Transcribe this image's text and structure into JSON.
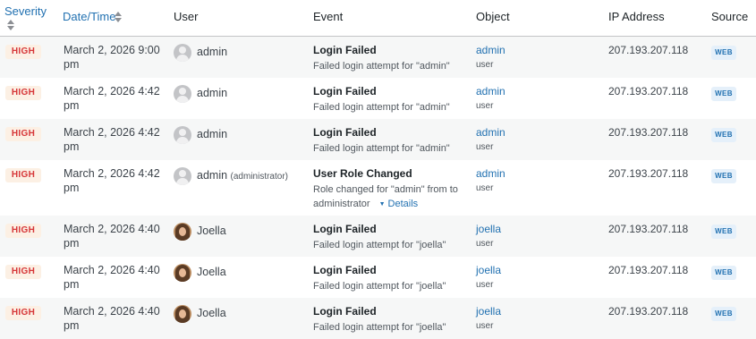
{
  "columns": {
    "severity": "Severity",
    "datetime": "Date/Time",
    "user": "User",
    "event": "Event",
    "object": "Object",
    "ip": "IP Address",
    "source": "Source"
  },
  "rows": [
    {
      "severity": "HIGH",
      "date": "March 2, 2026 9:00 pm",
      "user": "admin",
      "role": "",
      "avatar": "default-avatar",
      "event": "Login Failed",
      "desc": "Failed login attempt for \"admin\"",
      "object": "admin",
      "object_type": "user",
      "ip": "207.193.207.118",
      "source": "WEB"
    },
    {
      "severity": "HIGH",
      "date": "March 2, 2026 4:42 pm",
      "user": "admin",
      "role": "",
      "avatar": "default-avatar",
      "event": "Login Failed",
      "desc": "Failed login attempt for \"admin\"",
      "object": "admin",
      "object_type": "user",
      "ip": "207.193.207.118",
      "source": "WEB"
    },
    {
      "severity": "HIGH",
      "date": "March 2, 2026 4:42 pm",
      "user": "admin",
      "role": "",
      "avatar": "default-avatar",
      "event": "Login Failed",
      "desc": "Failed login attempt for \"admin\"",
      "object": "admin",
      "object_type": "user",
      "ip": "207.193.207.118",
      "source": "WEB"
    },
    {
      "severity": "HIGH",
      "date": "March 2, 2026 4:42 pm",
      "user": "admin",
      "role": "(administrator)",
      "avatar": "default-avatar",
      "event": "User Role Changed",
      "desc": "Role changed for \"admin\" from to administrator",
      "details": "Details",
      "object": "admin",
      "object_type": "user",
      "ip": "207.193.207.118",
      "source": "WEB"
    },
    {
      "severity": "HIGH",
      "date": "March 2, 2026 4:40 pm",
      "user": "Joella",
      "role": "",
      "avatar": "photo-avatar",
      "event": "Login Failed",
      "desc": "Failed login attempt for \"joella\"",
      "object": "joella",
      "object_type": "user",
      "ip": "207.193.207.118",
      "source": "WEB"
    },
    {
      "severity": "HIGH",
      "date": "March 2, 2026 4:40 pm",
      "user": "Joella",
      "role": "",
      "avatar": "photo-avatar",
      "event": "Login Failed",
      "desc": "Failed login attempt for \"joella\"",
      "object": "joella",
      "object_type": "user",
      "ip": "207.193.207.118",
      "source": "WEB"
    },
    {
      "severity": "HIGH",
      "date": "March 2, 2026 4:40 pm",
      "user": "Joella",
      "role": "",
      "avatar": "photo-avatar",
      "event": "Login Failed",
      "desc": "Failed login attempt for \"joella\"",
      "object": "joella",
      "object_type": "user",
      "ip": "207.193.207.118",
      "source": "WEB"
    }
  ]
}
